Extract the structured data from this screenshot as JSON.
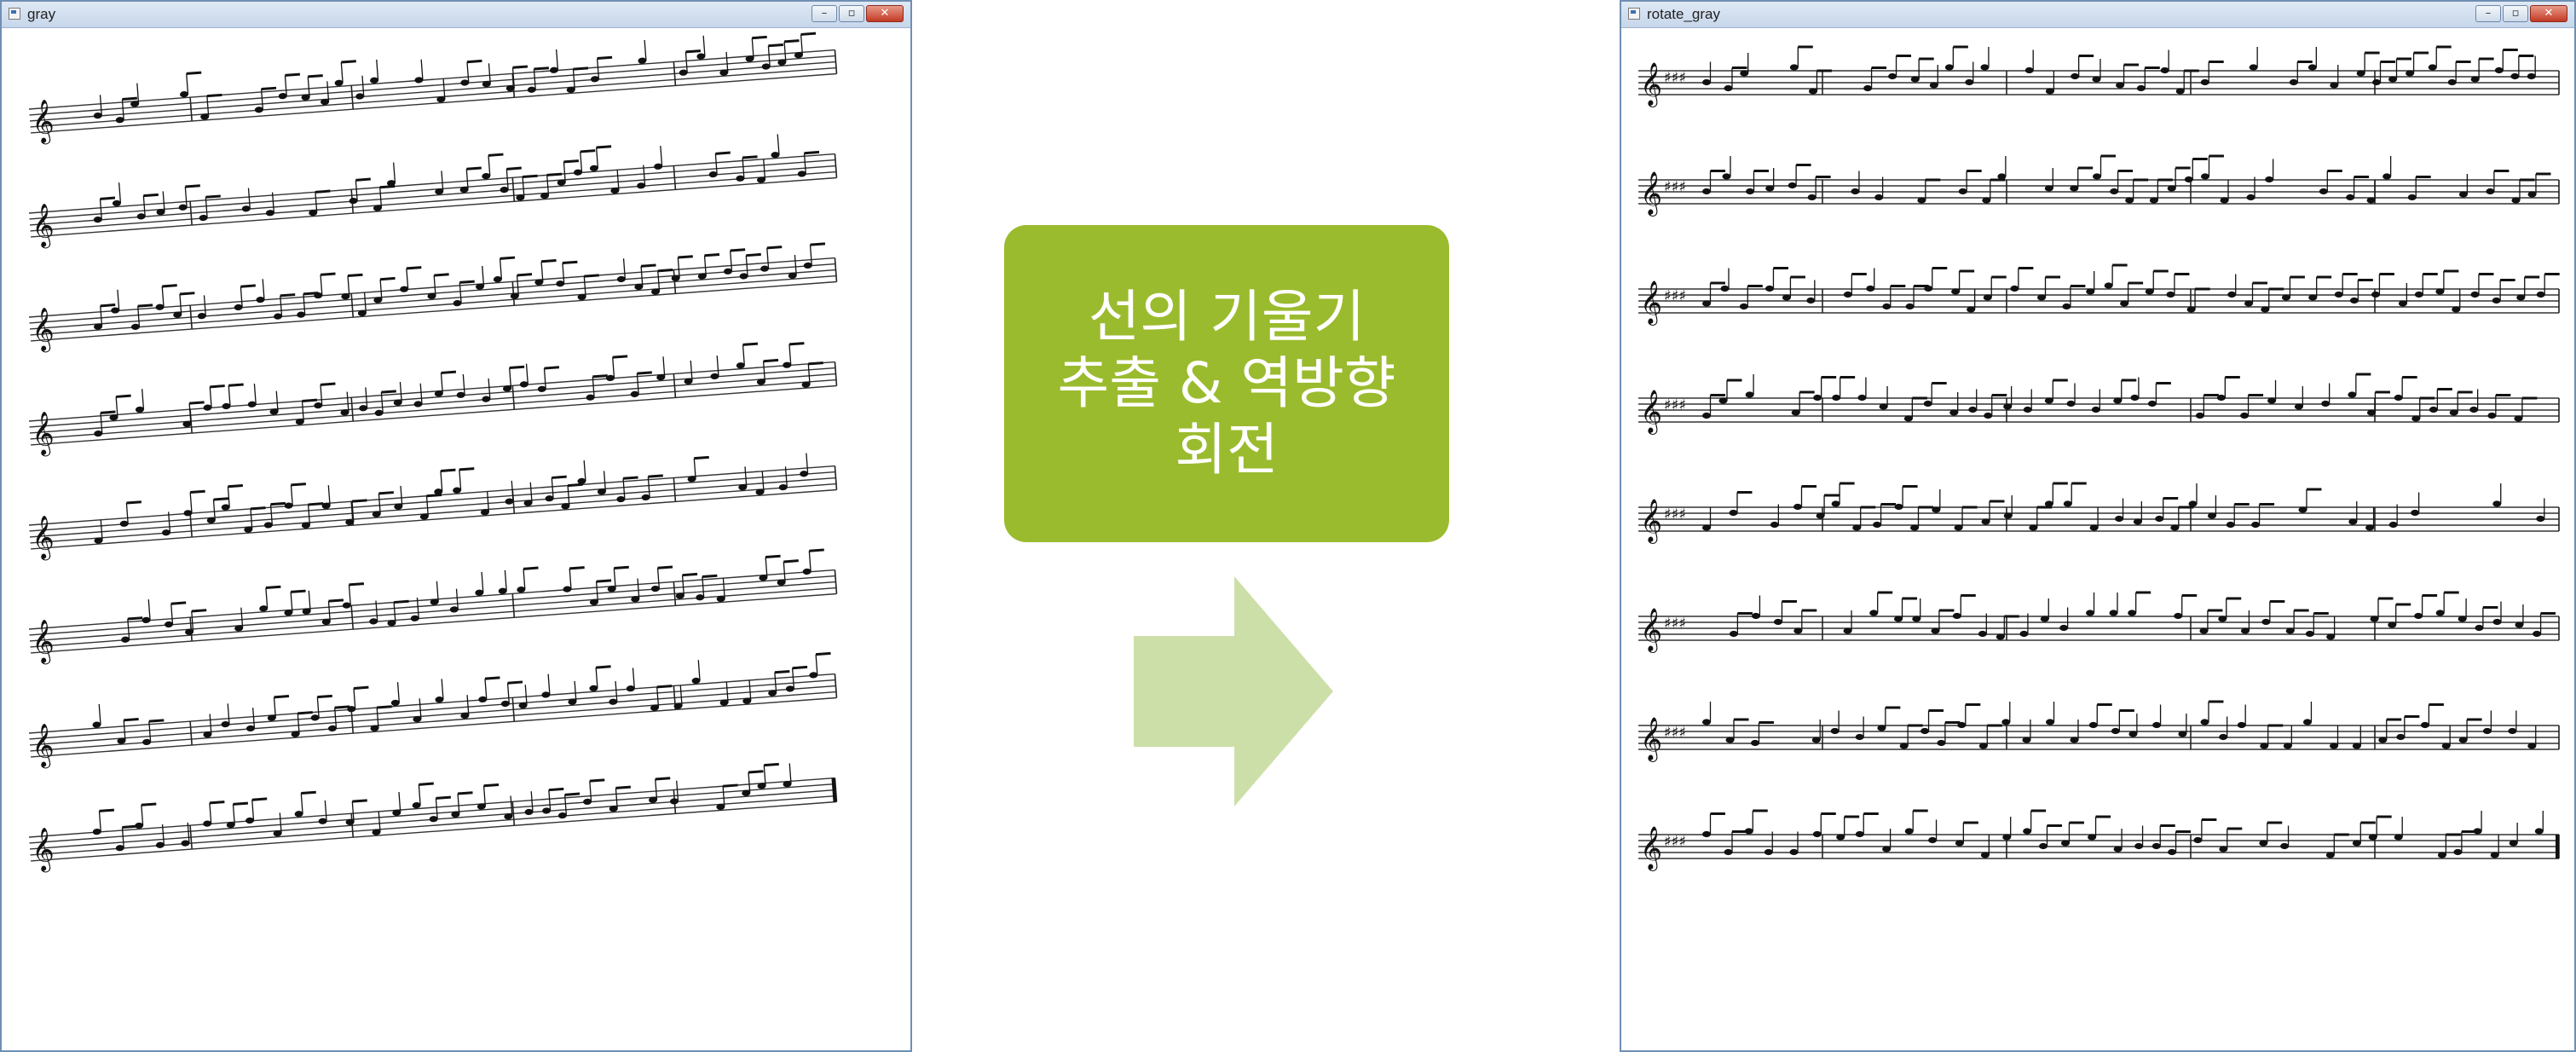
{
  "left_window": {
    "title": "gray",
    "controls": {
      "minimize": "–",
      "restore": "▫",
      "close": "✕"
    }
  },
  "right_window": {
    "title": "rotate_gray",
    "controls": {
      "minimize": "–",
      "restore": "▫",
      "close": "✕"
    }
  },
  "label_box": {
    "line1": "선의 기울기",
    "line2": "추출 & 역방향",
    "line3": "회전",
    "color": "#9bbb2e"
  },
  "arrow": {
    "icon": "right-arrow-icon",
    "color": "#cddfa8"
  },
  "sheet_music": {
    "staff_systems": 8
  }
}
